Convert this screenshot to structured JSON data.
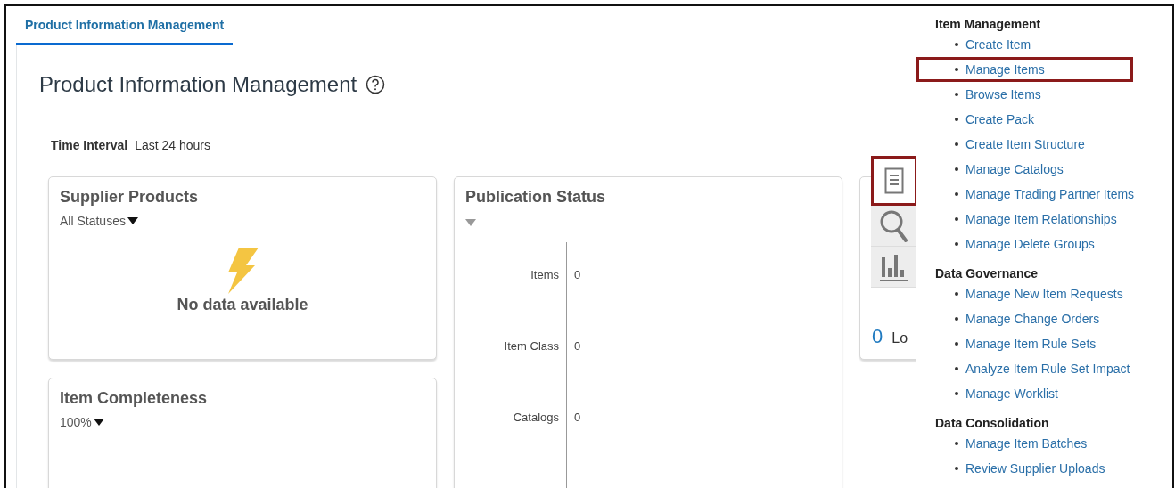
{
  "tabs": [
    {
      "label": "Product Information Management",
      "selected": true
    }
  ],
  "page_title": "Product Information Management",
  "time_interval": {
    "label": "Time Interval",
    "value": "Last 24 hours"
  },
  "columns": [
    [
      {
        "kind": "empty",
        "title": "Supplier Products",
        "filter": "All Statuses",
        "message": "No data available"
      },
      {
        "kind": "empty",
        "title": "Item Completeness",
        "filter": "100%"
      }
    ],
    [
      {
        "kind": "status",
        "title": "Publication Status",
        "rows": [
          {
            "label": "Items",
            "value": "0"
          },
          {
            "label": "Item Class",
            "value": "0"
          },
          {
            "label": "Catalogs",
            "value": "0"
          }
        ]
      }
    ],
    [
      {
        "kind": "summary",
        "count": "0",
        "label": "Lo",
        "tools": [
          {
            "kind": "document",
            "selected": true,
            "highlighted": true
          },
          {
            "kind": "search",
            "selected": false,
            "highlighted": false
          },
          {
            "kind": "bar-chart",
            "selected": false,
            "highlighted": false
          }
        ]
      }
    ]
  ],
  "menu": {
    "groups": [
      {
        "heading": "Item Management",
        "items": [
          {
            "label": "Create Item",
            "highlighted": false
          },
          {
            "label": "Manage Items",
            "highlighted": true
          },
          {
            "label": "Browse Items",
            "highlighted": false
          },
          {
            "label": "Create Pack",
            "highlighted": false
          },
          {
            "label": "Create Item Structure",
            "highlighted": false
          },
          {
            "label": "Manage Catalogs",
            "highlighted": false
          },
          {
            "label": "Manage Trading Partner Items",
            "highlighted": false
          },
          {
            "label": "Manage Item Relationships",
            "highlighted": false
          },
          {
            "label": "Manage Delete Groups",
            "highlighted": false
          }
        ]
      },
      {
        "heading": "Data Governance",
        "items": [
          {
            "label": "Manage New Item Requests",
            "highlighted": false
          },
          {
            "label": "Manage Change Orders",
            "highlighted": false
          },
          {
            "label": "Manage Item Rule Sets",
            "highlighted": false
          },
          {
            "label": "Analyze Item Rule Set Impact",
            "highlighted": false
          },
          {
            "label": "Manage Worklist",
            "highlighted": false
          }
        ]
      },
      {
        "heading": "Data Consolidation",
        "items": [
          {
            "label": "Manage Item Batches",
            "highlighted": false
          },
          {
            "label": "Review Supplier Uploads",
            "highlighted": false
          }
        ]
      }
    ]
  }
}
